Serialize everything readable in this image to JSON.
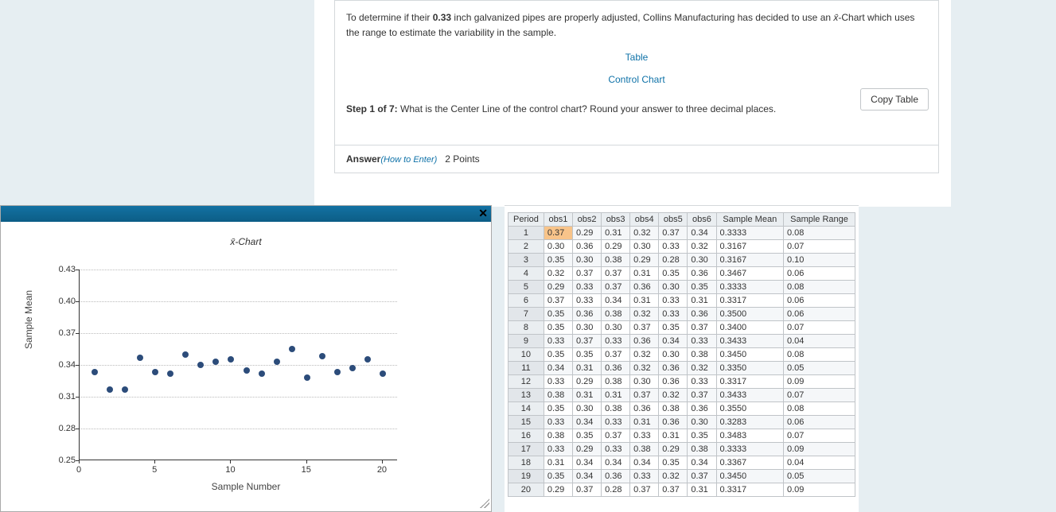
{
  "question": {
    "intro_prefix": "To determine if their ",
    "pipe_size": "0.33",
    "intro_mid": " inch galvanized pipes are properly adjusted, Collins Manufacturing has decided to use an ",
    "chart_symbol": "x̄",
    "intro_suffix": "-Chart which uses the range to estimate the variability in the sample.",
    "link_table": "Table",
    "link_control_chart": "Control Chart",
    "copy_btn": "Copy Table",
    "step_label": "Step 1 of 7:",
    "step_text": " What is the Center Line of the control chart? Round your answer to three decimal places.",
    "answer_label": "Answer",
    "how_to_enter": "(How to Enter)",
    "points": "2 Points"
  },
  "chart_data": {
    "type": "scatter",
    "title": "x̄-Chart",
    "xlabel": "Sample Number",
    "ylabel": "Sample Mean",
    "xlim": [
      0,
      21
    ],
    "ylim": [
      0.25,
      0.43
    ],
    "yticks": [
      0.25,
      0.28,
      0.31,
      0.34,
      0.37,
      0.4,
      0.43
    ],
    "xticks": [
      0,
      5,
      10,
      15,
      20
    ],
    "x": [
      1,
      2,
      3,
      4,
      5,
      6,
      7,
      8,
      9,
      10,
      11,
      12,
      13,
      14,
      15,
      16,
      17,
      18,
      19,
      20
    ],
    "y": [
      0.3333,
      0.3167,
      0.3167,
      0.3467,
      0.3333,
      0.3317,
      0.35,
      0.34,
      0.3433,
      0.345,
      0.335,
      0.3317,
      0.3433,
      0.355,
      0.3283,
      0.3483,
      0.3333,
      0.3367,
      0.345,
      0.3317
    ]
  },
  "table": {
    "headers": [
      "Period",
      "obs1",
      "obs2",
      "obs3",
      "obs4",
      "obs5",
      "obs6",
      "Sample Mean",
      "Sample Range"
    ],
    "rows": [
      {
        "period": 1,
        "obs": [
          0.37,
          0.29,
          0.31,
          0.32,
          0.37,
          0.34
        ],
        "mean": 0.3333,
        "range": 0.08,
        "active_cell": 0
      },
      {
        "period": 2,
        "obs": [
          0.3,
          0.36,
          0.29,
          0.3,
          0.33,
          0.32
        ],
        "mean": 0.3167,
        "range": 0.07
      },
      {
        "period": 3,
        "obs": [
          0.35,
          0.3,
          0.38,
          0.29,
          0.28,
          0.3
        ],
        "mean": 0.3167,
        "range": 0.1
      },
      {
        "period": 4,
        "obs": [
          0.32,
          0.37,
          0.37,
          0.31,
          0.35,
          0.36
        ],
        "mean": 0.3467,
        "range": 0.06
      },
      {
        "period": 5,
        "obs": [
          0.29,
          0.33,
          0.37,
          0.36,
          0.3,
          0.35
        ],
        "mean": 0.3333,
        "range": 0.08
      },
      {
        "period": 6,
        "obs": [
          0.37,
          0.33,
          0.34,
          0.31,
          0.33,
          0.31
        ],
        "mean": 0.3317,
        "range": 0.06
      },
      {
        "period": 7,
        "obs": [
          0.35,
          0.36,
          0.38,
          0.32,
          0.33,
          0.36
        ],
        "mean": 0.35,
        "range": 0.06
      },
      {
        "period": 8,
        "obs": [
          0.35,
          0.3,
          0.3,
          0.37,
          0.35,
          0.37
        ],
        "mean": 0.34,
        "range": 0.07
      },
      {
        "period": 9,
        "obs": [
          0.33,
          0.37,
          0.33,
          0.36,
          0.34,
          0.33
        ],
        "mean": 0.3433,
        "range": 0.04
      },
      {
        "period": 10,
        "obs": [
          0.35,
          0.35,
          0.37,
          0.32,
          0.3,
          0.38
        ],
        "mean": 0.345,
        "range": 0.08
      },
      {
        "period": 11,
        "obs": [
          0.34,
          0.31,
          0.36,
          0.32,
          0.36,
          0.32
        ],
        "mean": 0.335,
        "range": 0.05
      },
      {
        "period": 12,
        "obs": [
          0.33,
          0.29,
          0.38,
          0.3,
          0.36,
          0.33
        ],
        "mean": 0.3317,
        "range": 0.09
      },
      {
        "period": 13,
        "obs": [
          0.38,
          0.31,
          0.31,
          0.37,
          0.32,
          0.37
        ],
        "mean": 0.3433,
        "range": 0.07
      },
      {
        "period": 14,
        "obs": [
          0.35,
          0.3,
          0.38,
          0.36,
          0.38,
          0.36
        ],
        "mean": 0.355,
        "range": 0.08
      },
      {
        "period": 15,
        "obs": [
          0.33,
          0.34,
          0.33,
          0.31,
          0.36,
          0.3
        ],
        "mean": 0.3283,
        "range": 0.06
      },
      {
        "period": 16,
        "obs": [
          0.38,
          0.35,
          0.37,
          0.33,
          0.31,
          0.35
        ],
        "mean": 0.3483,
        "range": 0.07
      },
      {
        "period": 17,
        "obs": [
          0.33,
          0.29,
          0.33,
          0.38,
          0.29,
          0.38
        ],
        "mean": 0.3333,
        "range": 0.09
      },
      {
        "period": 18,
        "obs": [
          0.31,
          0.34,
          0.34,
          0.34,
          0.35,
          0.34
        ],
        "mean": 0.3367,
        "range": 0.04
      },
      {
        "period": 19,
        "obs": [
          0.35,
          0.34,
          0.36,
          0.33,
          0.32,
          0.37
        ],
        "mean": 0.345,
        "range": 0.05
      },
      {
        "period": 20,
        "obs": [
          0.29,
          0.37,
          0.28,
          0.37,
          0.37,
          0.31
        ],
        "mean": 0.3317,
        "range": 0.09
      }
    ]
  }
}
